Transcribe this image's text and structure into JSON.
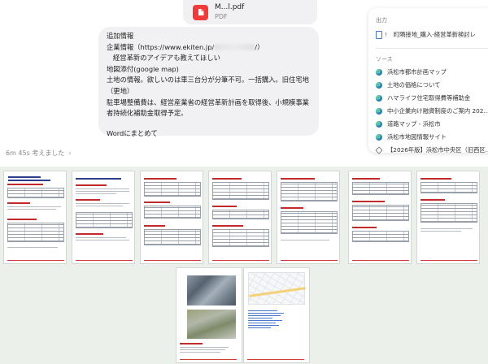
{
  "attachment": {
    "file_name": "M...l.pdf",
    "file_type": "PDF",
    "icon": "pdf-file-icon",
    "icon_color": "#f13a3a"
  },
  "message": {
    "lines": [
      "追加情報",
      "企業情報（https://www.ekiten.jp/",
      "/）",
      "経営革新のアイデアも教えてほしい",
      "地図添付(google map)",
      "土地の情報。欲しいのは車三台分が分筆不可。一括購入。旧住宅地（更地）",
      "駐車場整備費は、経営産業省の経営革新計画を取得後、小規模事業者持続化補助金取得予定。",
      "Wordにまとめて"
    ]
  },
  "panel": {
    "output_heading": "出力",
    "output_item": "町隣接地_購入-経営革新検討レ",
    "sources_heading": "ソース",
    "sources": [
      {
        "label": "浜松市都市計画マップ",
        "icon": "globe-icon"
      },
      {
        "label": "土地の価格について",
        "icon": "globe-icon"
      },
      {
        "label": "ハマライフ住宅取得費等補助金",
        "icon": "globe-icon"
      },
      {
        "label": "中小企業向け融資制度のご案内 202...",
        "icon": "globe-icon"
      },
      {
        "label": "道路マップ - 浜松市",
        "icon": "globe-icon"
      },
      {
        "label": "浜松市地図情報サイト",
        "icon": "globe-icon"
      },
      {
        "label": "【2026年版】浜松市中央区（旧西区...",
        "icon": "cube-icon"
      }
    ]
  },
  "thought": {
    "label": "6m 45s 考えました",
    "icon": "chevron-right-icon"
  },
  "preview": {
    "background": "#ecf0eb",
    "accent_red": "#c22b2b",
    "title_blue": "#2c3e8c"
  }
}
